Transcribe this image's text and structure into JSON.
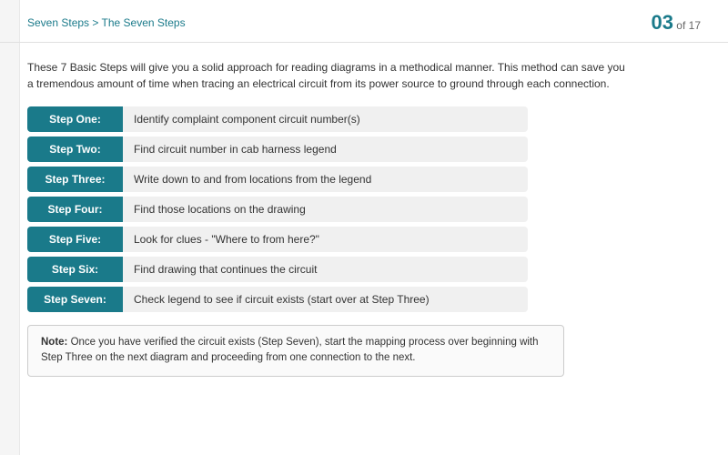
{
  "breadcrumb": {
    "root": "Seven Steps",
    "separator": " > ",
    "current": "The Seven Steps"
  },
  "pagination": {
    "current": "03",
    "total": "17",
    "of_label": "of"
  },
  "intro": {
    "text": "These 7 Basic Steps will give you a solid approach for reading diagrams in a methodical manner. This method can save you a tremendous amount of time when tracing an electrical circuit from its power source to ground through each connection."
  },
  "steps": [
    {
      "label": "Step One:",
      "content": "Identify complaint component circuit number(s)"
    },
    {
      "label": "Step Two:",
      "content": "Find circuit number in cab harness legend"
    },
    {
      "label": "Step Three:",
      "content": "Write down to and from locations from the legend"
    },
    {
      "label": "Step Four:",
      "content": "Find those locations on the drawing"
    },
    {
      "label": "Step Five:",
      "content": "Look for clues - \"Where to from here?\""
    },
    {
      "label": "Step Six:",
      "content": "Find drawing that continues the circuit"
    },
    {
      "label": "Step Seven:",
      "content": "Check legend to see if circuit exists (start over at Step Three)"
    }
  ],
  "note": {
    "label": "Note:",
    "text": " Once you have verified the circuit exists (Step Seven), start the mapping process over beginning with Step Three on the next diagram and proceeding from one connection to the next."
  }
}
